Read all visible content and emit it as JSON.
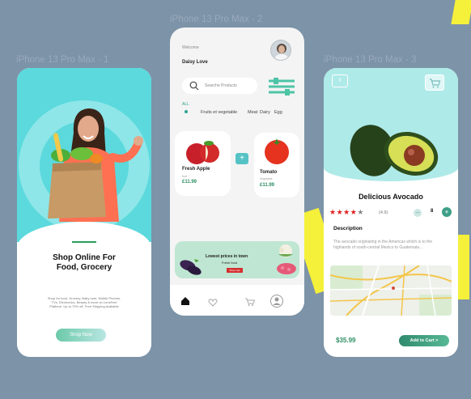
{
  "frames": {
    "frame1": "iPhone 13 Pro Max - 1",
    "frame2": "iPhone 13 Pro Max - 2",
    "frame3": "iPhone 13 Pro Max - 3"
  },
  "colors": {
    "canvas": "#7c93a8",
    "accent_teal": "#5bd9dc",
    "accent_green": "#2e8f63",
    "highlight_yellow": "#f5f03a",
    "star_red": "#e02020"
  },
  "onboarding": {
    "title_line1": "Shop Online For",
    "title_line2": "Food, Grocery",
    "description": "Shop for food, Grocery, Baby care, Mobile Phones, TVs, Electronics, Beauty & more on LensFeel Platform. Up to 70% off. Free Shipping Available",
    "cta": "Shop Now"
  },
  "home": {
    "welcome": "Welcome",
    "user_name": "Daisy Love",
    "search_placeholder": "Searche Products",
    "categories_label": "ALL",
    "categories": [
      "Fruits et vegetable",
      "Meat",
      "Dairy",
      "Egg"
    ],
    "products": [
      {
        "name": "Fresh Apple",
        "sub": "fruit",
        "price": "£11.99"
      },
      {
        "name": "Tomato",
        "sub": "Vegetable",
        "price": "£11.99"
      }
    ],
    "banner": {
      "title": "Lowest prices in town",
      "subtitle": "Fresh food",
      "button": "Shop now"
    },
    "nav": [
      "home-icon",
      "heart-icon",
      "cart-icon",
      "profile-icon"
    ]
  },
  "detail": {
    "title": "Delicious Avocado",
    "rating_stars": 4,
    "rating_text": "(4.9)",
    "quantity": "8",
    "description_heading": "Description",
    "description_text": "The avocado originating in the Americas which is to the highlands of south-central Mexico to Guatemala...",
    "price": "$35.99",
    "cta": "Add to Cart >"
  }
}
